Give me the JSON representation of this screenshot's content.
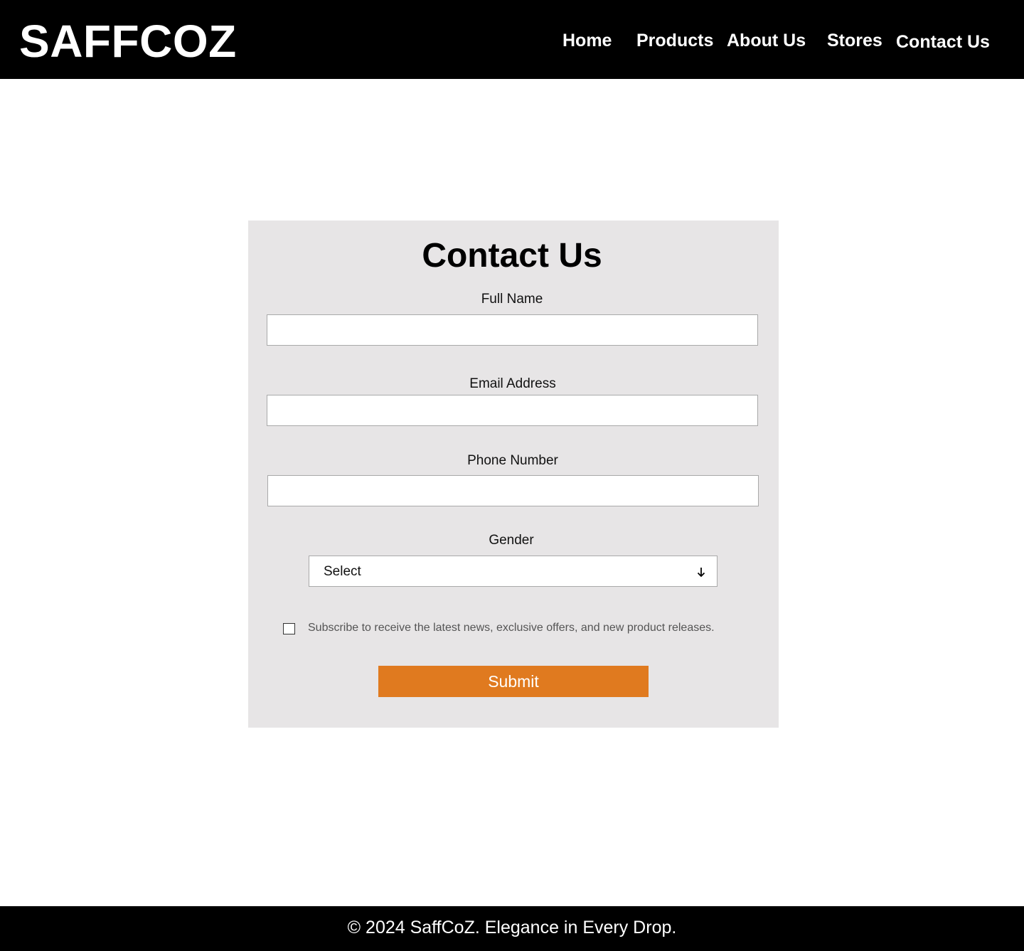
{
  "header": {
    "brand": "SAFFCOZ",
    "nav": [
      "Home",
      "Products",
      "About Us",
      "Stores",
      "Contact Us"
    ]
  },
  "form": {
    "title": "Contact Us",
    "full_name_label": "Full Name",
    "full_name_value": "",
    "email_label": "Email Address",
    "email_value": "",
    "phone_label": "Phone Number",
    "phone_value": "",
    "gender_label": "Gender",
    "gender_selected": "Select",
    "subscribe_label": "Subscribe to receive the latest news, exclusive offers, and new product releases.",
    "subscribe_checked": false,
    "submit_label": "Submit"
  },
  "footer": {
    "text": "© 2024 SaffCoZ. Elegance in Every Drop."
  },
  "colors": {
    "header_bg": "#000000",
    "card_bg": "#e7e5e6",
    "submit_bg": "#e07a1f",
    "footer_bg": "#000000"
  },
  "icons": {
    "select_arrow": "arrow-down-icon"
  }
}
